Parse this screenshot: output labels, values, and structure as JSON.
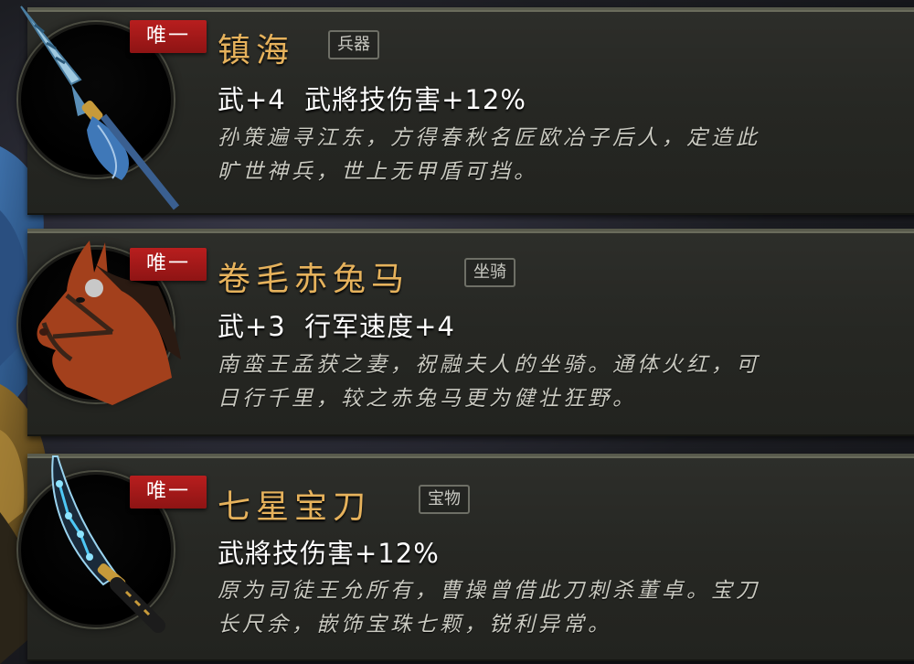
{
  "items": [
    {
      "badge": "唯一",
      "name": "镇海",
      "type": "兵器",
      "stats": "武+4  武將技伤害+12%",
      "desc_line1": "孙策遍寻江东，方得春秋名匠欧冶子后人，定造此",
      "desc_line2": "旷世神兵，世上无甲盾可挡。",
      "icon": "spear-icon"
    },
    {
      "badge": "唯一",
      "name": "卷毛赤兔马",
      "type": "坐骑",
      "stats": "武+3  行军速度+4",
      "desc_line1": "南蛮王孟获之妻，祝融夫人的坐骑。通体火红，可",
      "desc_line2": "日行千里，较之赤兔马更为健壮狂野。",
      "icon": "horse-icon"
    },
    {
      "badge": "唯一",
      "name": "七星宝刀",
      "type": "宝物",
      "stats": "武將技伤害+12%",
      "desc_line1": "原为司徒王允所有，曹操曾借此刀刺杀董卓。宝刀",
      "desc_line2": "长尺余，嵌饰宝珠七颗，锐利异常。",
      "icon": "dagger-icon"
    }
  ],
  "colors": {
    "name": "#e6b25c",
    "badge": "#b81e1e",
    "stats": "#ffffff",
    "desc": "#c9c9c0"
  }
}
